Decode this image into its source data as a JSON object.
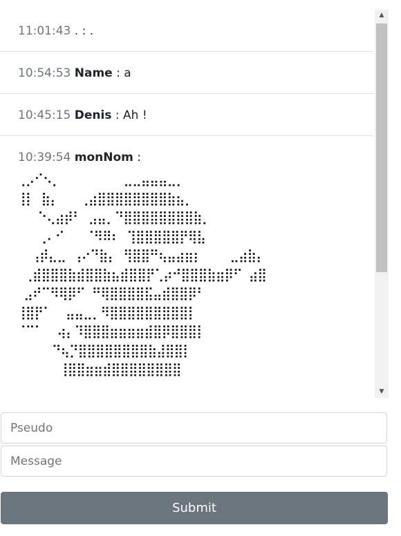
{
  "messages": [
    {
      "time": "11:01:43",
      "nick": "",
      "sep": "",
      "text": ". : ."
    },
    {
      "time": "10:54:53",
      "nick": "Name",
      "sep": " : ",
      "text": "a"
    },
    {
      "time": "10:45:15",
      "nick": "Denis",
      "sep": " : ",
      "text": "Ah !"
    },
    {
      "time": "10:39:54",
      "nick": "monNom",
      "sep": " :",
      "text": "",
      "ascii": "⢀⡠⠊⠢⡀         ⣀⣀⣤⣤⣤⣀⡀\n⢸⡇ ⣷⡄   ⢀⣴⣿⣿⣿⣿⣿⣿⣿⣿⣷⣦⡀\n   ⠑⢄⣴⡾⠃ ⣠⣤⡀⠙⣿⣿⣿⣿⣿⣿⣿⣿⣷⡀\n   ⢀⠄⠊   ⠈⠻⠿⠆ ⢹⣿⣿⣿⣿⣿⡟⢿⣧\n  ⢠⡾⣄⣀ ⢠⠔⠙⣷⡄ ⢻⣿⣿⠛⢦⣤⣴⣶⡆    ⣀⣴⣷⡄\n ⢀⣾⣿⣿⣿⣷⣾⣿⣿⣷⣦⣾⣿⣿⡟⢁⡴⠚⣿⣿⣿⣷⣶⡿⠋ ⣴⣿\n ⣠⠞⠉⠻⢿⡿⠋ ⠛⢿⣿⣿⣿⣿⣯⣤⣾⣿⣿⡿⠃\n⢸⣿⡟⠁  ⣤⣤⣀⡀⠻⣿⣿⣿⣿⣿⣿⣿⣿⣿⡇\n⠈⠉⠁  ⢴⡄⠹⣿⣿⣿⣶⣶⣶⣶⣾⣿⡿⣿⣿⣿⡇\n     ⠙⢦⡙⣿⣿⣿⣿⣿⣿⣿⣿⣷⣼⣿⣿⡇\n      ⢸⣿⣿⣶⣶⣾⣿⣿⣿⣿⣿⣿⣿⣿"
    }
  ],
  "form": {
    "pseudo_placeholder": "Pseudo",
    "message_placeholder": "Message",
    "submit_label": "Submit"
  },
  "colors": {
    "button": "#6c757d",
    "time": "#6c757d",
    "divider": "#dee2e6"
  }
}
